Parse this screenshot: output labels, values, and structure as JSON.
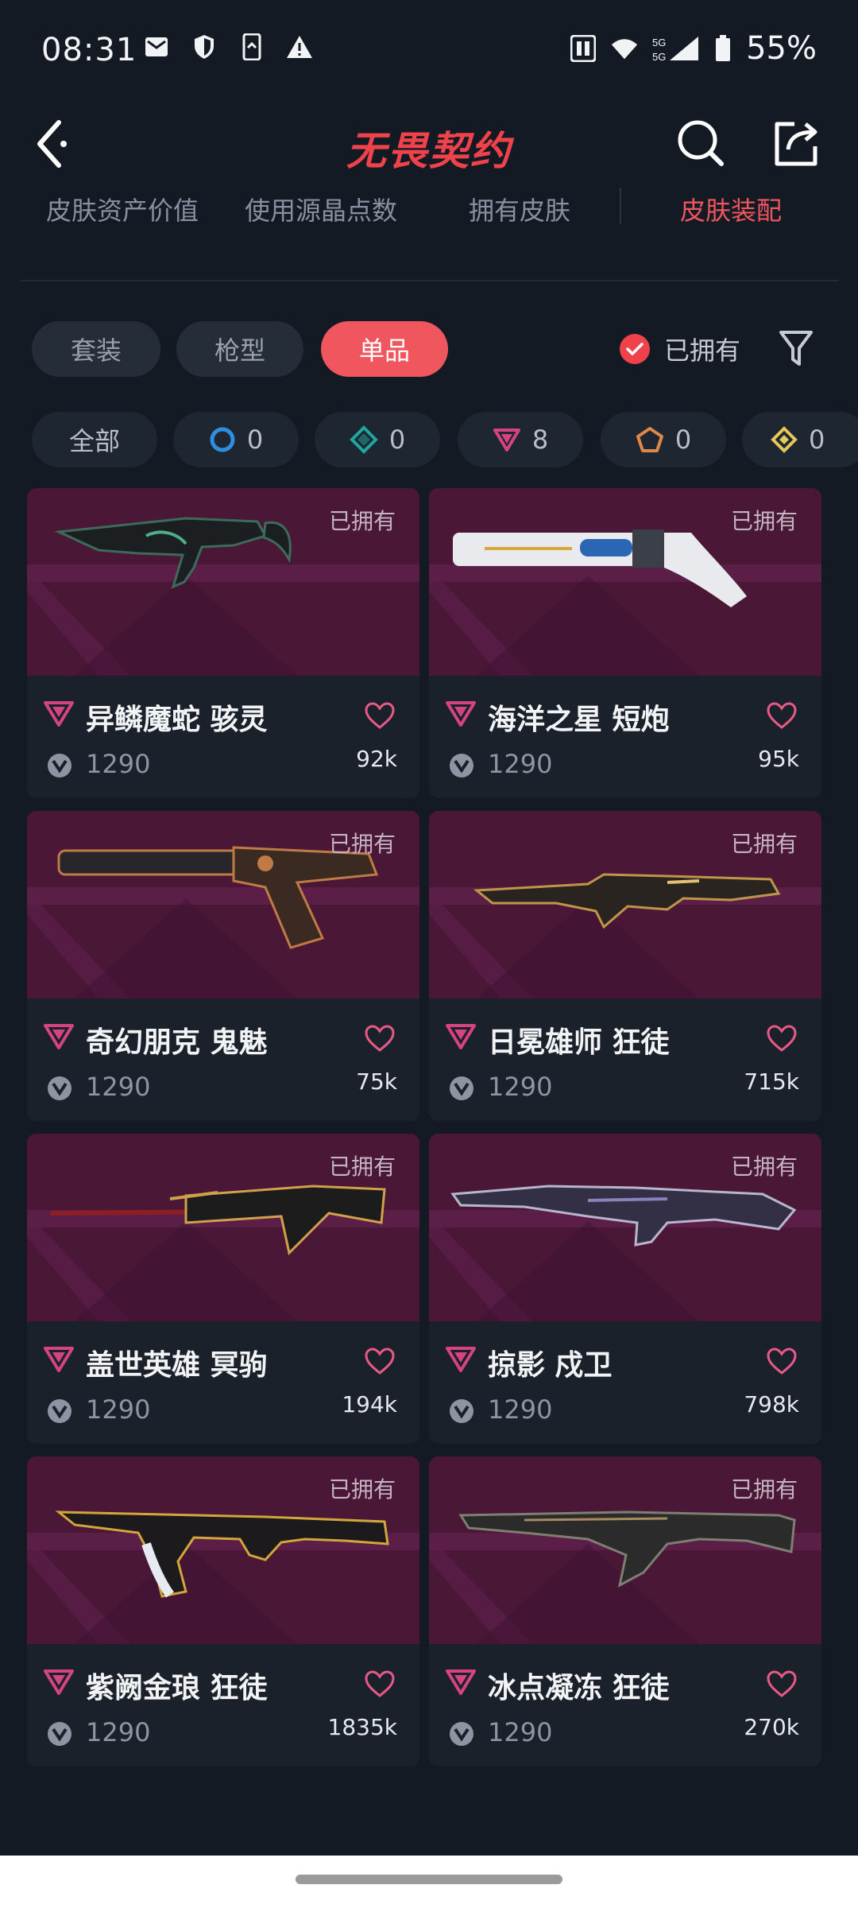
{
  "status": {
    "time": "08:31",
    "battery": "55%"
  },
  "header": {
    "title": "无畏契约"
  },
  "top_tabs": [
    {
      "label": "皮肤资产价值"
    },
    {
      "label": "使用源晶点数"
    },
    {
      "label": "拥有皮肤"
    },
    {
      "label": "皮肤装配"
    }
  ],
  "category": {
    "pills": [
      {
        "label": "套装"
      },
      {
        "label": "枪型"
      },
      {
        "label": "单品"
      }
    ],
    "owned_label": "已拥有"
  },
  "rarity_chips": [
    {
      "label": "全部"
    },
    {
      "count": "0",
      "icon": "select-tier-icon",
      "color": "#2e8ee0"
    },
    {
      "count": "0",
      "icon": "deluxe-tier-icon",
      "color": "#1fa6a0"
    },
    {
      "count": "8",
      "icon": "premium-tier-icon",
      "color": "#d6447f"
    },
    {
      "count": "0",
      "icon": "exclusive-tier-icon",
      "color": "#e0884a"
    },
    {
      "count": "0",
      "icon": "ultra-tier-icon",
      "color": "#e3c85a"
    }
  ],
  "cards": [
    {
      "owned": "已拥有",
      "name": "异鳞魔蛇 骇灵",
      "price": "1290",
      "likes": "92k"
    },
    {
      "owned": "已拥有",
      "name": "海洋之星 短炮",
      "price": "1290",
      "likes": "95k"
    },
    {
      "owned": "已拥有",
      "name": "奇幻朋克 鬼魅",
      "price": "1290",
      "likes": "75k"
    },
    {
      "owned": "已拥有",
      "name": "日冕雄师 狂徒",
      "price": "1290",
      "likes": "715k"
    },
    {
      "owned": "已拥有",
      "name": "盖世英雄 冥驹",
      "price": "1290",
      "likes": "194k"
    },
    {
      "owned": "已拥有",
      "name": "掠影 戍卫",
      "price": "1290",
      "likes": "798k"
    },
    {
      "owned": "已拥有",
      "name": "紫阙金琅 狂徒",
      "price": "1290",
      "likes": "1835k"
    },
    {
      "owned": "已拥有",
      "name": "冰点凝冻 狂徒",
      "price": "1290",
      "likes": "270k"
    }
  ],
  "colors": {
    "accent": "#f0565d",
    "premium": "#d6447f",
    "background": "#141a24"
  }
}
